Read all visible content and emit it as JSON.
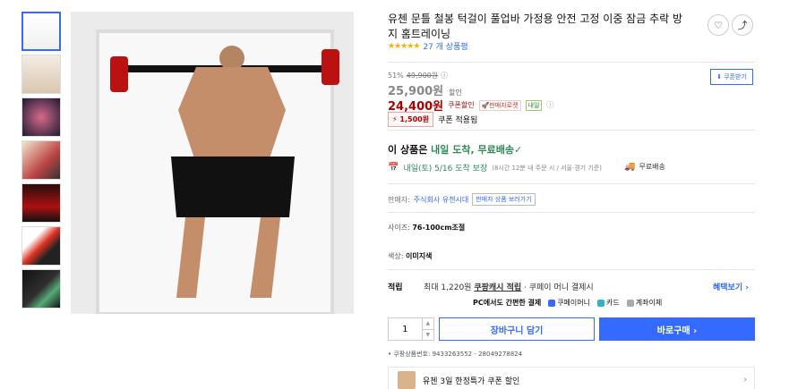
{
  "product": {
    "title": "유첸 문틀 철봉 턱걸이 풀업바 가정용 안전 고정 이중 잠금 추락 방지 홈트레이닝",
    "rating_stars": "★★★★★",
    "review_count": "27 개 상품평"
  },
  "pricing": {
    "discount_rate": "51%",
    "original_price": "49,900원",
    "info_mark": "ⓘ",
    "sale_price": "25,900원",
    "sale_label": "할인",
    "coupon_price": "24,400원",
    "coupon_label": "쿠폰할인",
    "rocket_badge": "🚀판매자로켓",
    "tomorrow_badge": "내일",
    "cash_amount": "1,500원",
    "cash_prefix": "⚡",
    "cash_label": "쿠폰 적용됨",
    "coupon_button": "⬇ 쿠폰받기"
  },
  "delivery": {
    "headline_prefix": "이 상품은 ",
    "headline_highlight": "내일 도착, 무료배송",
    "check": "✓",
    "calendar_icon": "📅",
    "date_text": "내일(토) 5/16 도착 보장",
    "cutoff_text": "(8시간 12분 내 주문 시 / 서울·경기 기준)",
    "truck_icon": "🚚",
    "rocket_delivery": "무료배송"
  },
  "seller": {
    "label": "판매자:",
    "name": "주식회사 유첸시대",
    "more_button": "판매자 상품 보러가기"
  },
  "options": {
    "size_key": "사이즈:",
    "size_value": "76-100cm조절",
    "color_key": "색상:",
    "color_value": "이미지색"
  },
  "cash_benefit": {
    "head": "적립",
    "desc_prefix": "최대 1,220원 ",
    "desc_u": "쿠팡캐시 적립",
    "desc_suffix": " · 쿠페이 머니 결제시",
    "link": "혜택보기 ›"
  },
  "payment": {
    "lead": "PC에서도 간편한 결제",
    "opt1": "쿠페이머니",
    "opt2": "카드",
    "opt3": "계좌이체"
  },
  "purchase": {
    "quantity": "1",
    "up": "▲",
    "down": "▼",
    "cart_label": "장바구니 담기",
    "buy_label": "바로구매 ›"
  },
  "product_id": "쿠팡상품번호: 9433263552 - 28049278824",
  "promo": {
    "text": "유첸 3일 한정특가 쿠폰 할인",
    "chevron": "›"
  },
  "icons": {
    "heart": "♡",
    "share": "⤴"
  },
  "colors": {
    "accent": "#346aff",
    "price_red": "#ae0000",
    "green": "#2e8b57",
    "star": "#f4b400"
  }
}
